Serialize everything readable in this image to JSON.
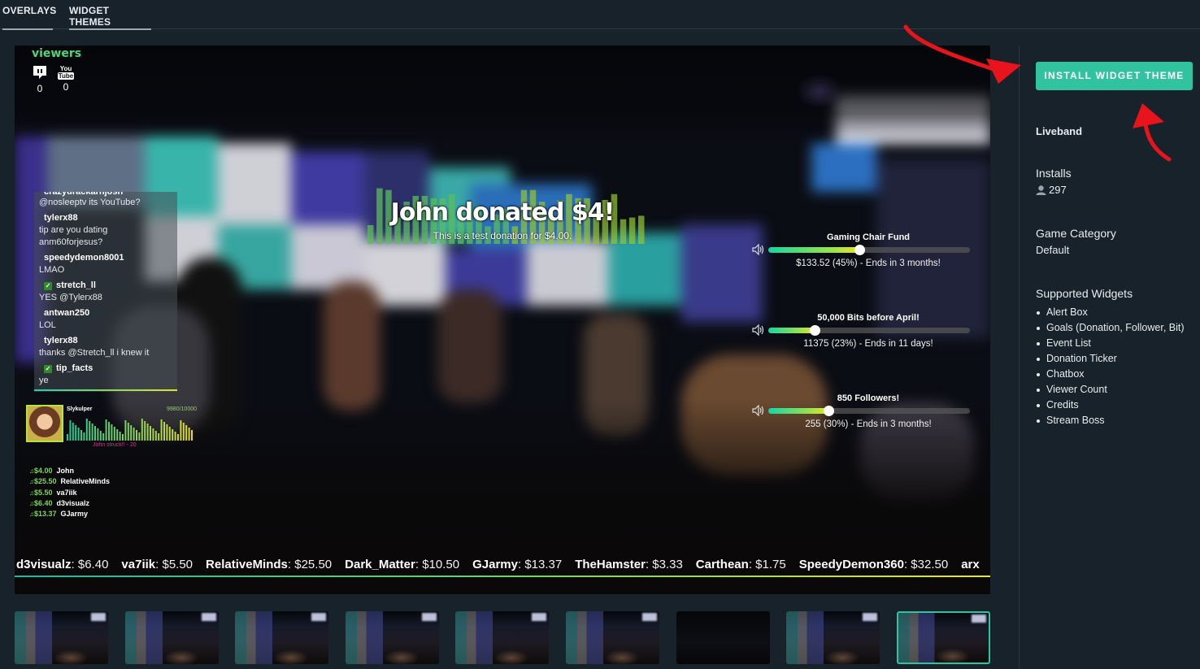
{
  "tabs": [
    {
      "label": "OVERLAYS",
      "active": false
    },
    {
      "label": "WIDGET THEMES",
      "active": true
    }
  ],
  "preview": {
    "viewer_count": {
      "title": "viewers",
      "platforms": [
        {
          "icon": "twitch-icon",
          "count": "0"
        },
        {
          "icon": "youtube-icon",
          "count": "0",
          "label_top": "You",
          "label_bottom": "Tube"
        }
      ]
    },
    "chatbox": {
      "top_partial_user": "crazydrackarnjosh",
      "top_message": "@nosleeptv its YouTube?",
      "messages": [
        {
          "user": "tylerx88",
          "badge": false,
          "lines": [
            "tip are you dating",
            "anm60forjesus?"
          ]
        },
        {
          "user": "speedydemon8001",
          "badge": false,
          "lines": [
            "LMAO"
          ]
        },
        {
          "user": "stretch_ll",
          "badge": true,
          "lines": [
            "YES @Tylerx88"
          ]
        },
        {
          "user": "antwan250",
          "badge": false,
          "lines": [
            "LOL"
          ]
        },
        {
          "user": "tylerx88",
          "badge": false,
          "lines": [
            "thanks @Stretch_ll i knew it"
          ]
        },
        {
          "user": "tip_facts",
          "badge": true,
          "lines": [
            "ye"
          ]
        }
      ]
    },
    "stream_boss": {
      "name": "Slykulper",
      "health": "9980/10000",
      "footer": "John struck!! - 20"
    },
    "event_list": [
      {
        "amount": "$4.00",
        "name": "John"
      },
      {
        "amount": "$25.50",
        "name": "RelativeMinds"
      },
      {
        "amount": "$5.50",
        "name": "va7iik"
      },
      {
        "amount": "$6.40",
        "name": "d3visualz"
      },
      {
        "amount": "$13.37",
        "name": "GJarmy"
      }
    ],
    "alert": {
      "title": "John donated $4!",
      "message": "This is a test donation for $4.00."
    },
    "goals": [
      {
        "title": "Gaming Chair Fund",
        "progress": 0.45,
        "subtitle": "$133.52 (45%) - Ends in 3 months!"
      },
      {
        "title": "50,000 Bits before April!",
        "progress": 0.23,
        "subtitle": "11375 (23%) - Ends in 11 days!"
      },
      {
        "title": "850 Followers!",
        "progress": 0.3,
        "subtitle": "255 (30%) - Ends in 3 months!"
      }
    ],
    "ticker": [
      {
        "name": "d3visualz",
        "amount": "$6.40"
      },
      {
        "name": "va7iik",
        "amount": "$5.50"
      },
      {
        "name": "RelativeMinds",
        "amount": "$25.50"
      },
      {
        "name": "Dark_Matter",
        "amount": "$10.50"
      },
      {
        "name": "GJarmy",
        "amount": "$13.37"
      },
      {
        "name": "TheHamster",
        "amount": "$3.33"
      },
      {
        "name": "Carthean",
        "amount": "$1.75"
      },
      {
        "name": "SpeedyDemon360",
        "amount": "$32.50"
      },
      {
        "name": "arx",
        "amount": ""
      }
    ]
  },
  "thumbnails": [
    {
      "label": "thumbnail-1",
      "selected": false
    },
    {
      "label": "thumbnail-2",
      "selected": false
    },
    {
      "label": "thumbnail-3",
      "selected": false
    },
    {
      "label": "thumbnail-4",
      "selected": false
    },
    {
      "label": "thumbnail-5",
      "selected": false
    },
    {
      "label": "thumbnail-6",
      "selected": false
    },
    {
      "label": "thumbnail-7",
      "selected": false
    },
    {
      "label": "thumbnail-8",
      "selected": false
    },
    {
      "label": "thumbnail-9",
      "selected": true
    }
  ],
  "sidebar": {
    "install_button": "INSTALL WIDGET THEME",
    "theme_name": "Liveband",
    "installs_label": "Installs",
    "installs_count": "297",
    "game_category_label": "Game Category",
    "game_category_value": "Default",
    "supported_widgets_label": "Supported Widgets",
    "supported_widgets": [
      "Alert Box",
      "Goals (Donation, Follower, Bit)",
      "Event List",
      "Donation Ticker",
      "Chatbox",
      "Viewer Count",
      "Credits",
      "Stream Boss"
    ]
  },
  "colors": {
    "accent": "#31c3a0",
    "background": "#17222b",
    "annotation_arrow": "#e8141c"
  }
}
